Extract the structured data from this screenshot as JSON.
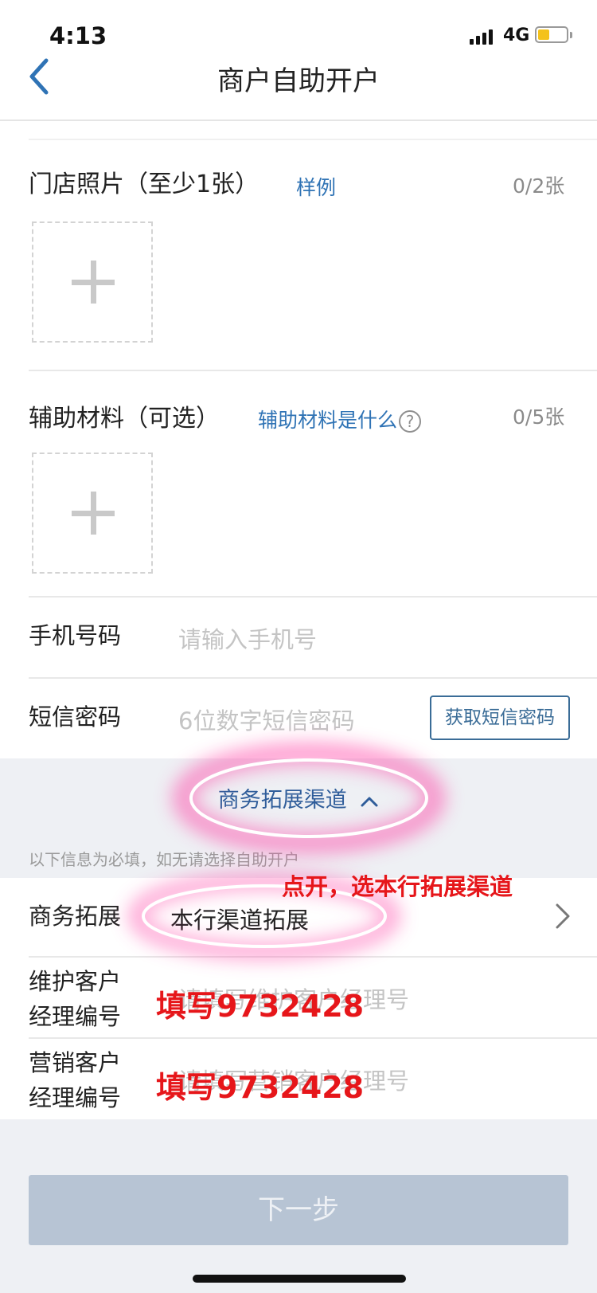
{
  "status_bar": {
    "time": "4:13",
    "network": "4G"
  },
  "nav": {
    "title": "商户自助开户"
  },
  "store_photos": {
    "label": "门店照片（至少1张）",
    "sample_link": "样例",
    "count": "0/2张"
  },
  "aux_materials": {
    "label": "辅助材料（可选）",
    "help_link": "辅助材料是什么",
    "help_icon": "?",
    "count": "0/5张"
  },
  "phone": {
    "label": "手机号码",
    "placeholder": "请输入手机号"
  },
  "sms": {
    "label": "短信密码",
    "placeholder": "6位数字短信密码",
    "button": "获取短信密码"
  },
  "channel_toggle": {
    "label": "商务拓展渠道"
  },
  "required_note": "以下信息为必填，如无请选择自助开户",
  "biz_expansion": {
    "label": "商务拓展",
    "value": "本行渠道拓展"
  },
  "maintain_manager": {
    "label_line1": "维护客户",
    "label_line2": "经理编号",
    "placeholder": "请填写维护客户经理号"
  },
  "marketing_manager": {
    "label_line1": "营销客户",
    "label_line2": "经理编号",
    "placeholder": "请填写营销客户经理号"
  },
  "next_button": "下一步",
  "annotations": {
    "hint_channel": "点开，选本行拓展渠道",
    "fill_maintain": "填写9732428",
    "fill_marketing": "填写9732428",
    "color": "#e6161a"
  },
  "colors": {
    "link": "#2f73b5",
    "accent_border": "#3a6c97",
    "highlight": "#ff3fa4",
    "button_disabled": "#b7c4d4"
  },
  "icons": [
    "back-chevron-icon",
    "plus-icon",
    "help-circle-icon",
    "chevron-up-icon",
    "chevron-right-icon",
    "signal-icon",
    "battery-icon"
  ]
}
